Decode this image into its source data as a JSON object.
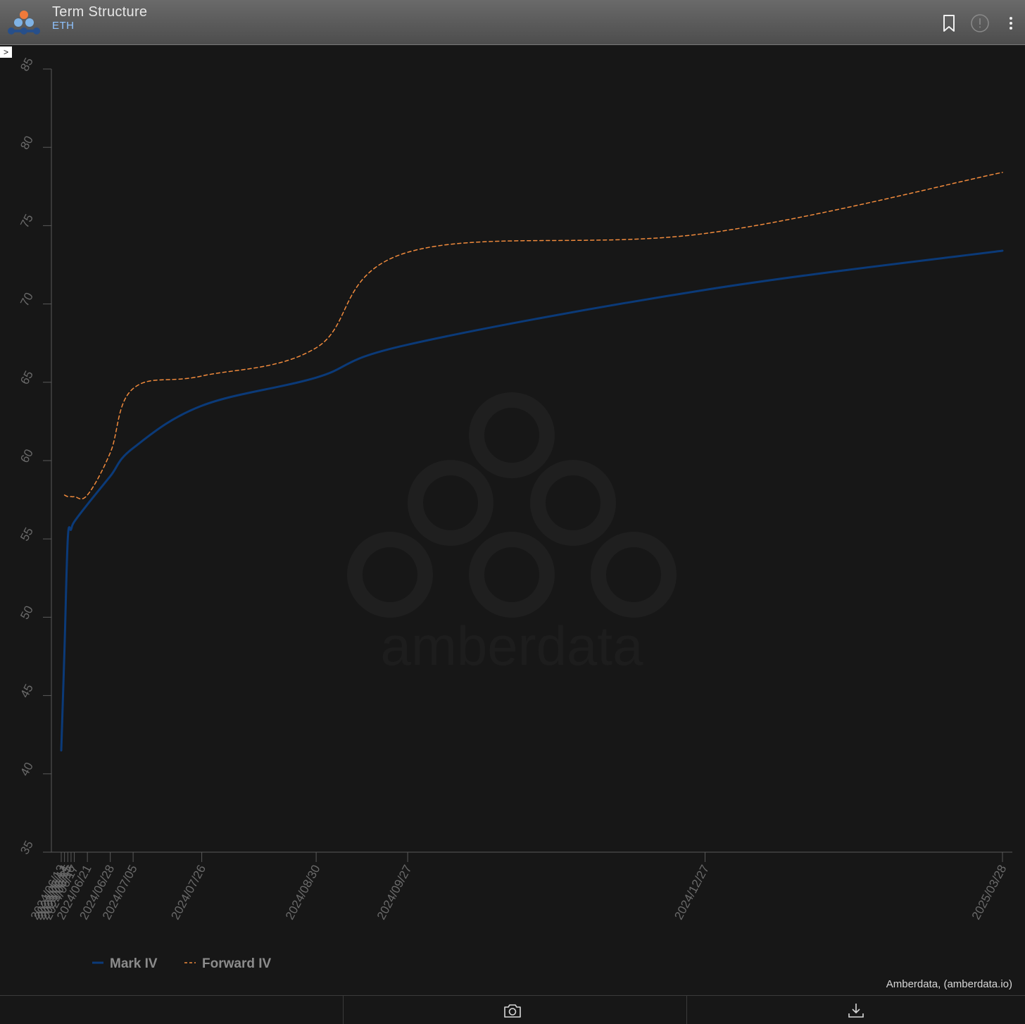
{
  "header": {
    "title": "Term Structure",
    "subtitle": "ETH"
  },
  "icons": {
    "logo": "amberdata-logo-icon",
    "bookmark": "bookmark-icon",
    "info": "alert-circle-icon",
    "menu": "vertical-dots-icon",
    "collapse": "chevron-right-icon",
    "camera": "camera-icon",
    "download": "download-icon"
  },
  "collapse_label": ">",
  "watermark": "amberdata",
  "credit": "Amberdata, (amberdata.io)",
  "colors": {
    "background": "#171717",
    "mark_iv": "#0b3a78",
    "forward_iv": "#f08a3c",
    "accent": "#8fc3ff"
  },
  "chart_data": {
    "type": "line",
    "title": "",
    "xlabel": "",
    "ylabel": "",
    "ylim": [
      35,
      85
    ],
    "y_ticks": [
      35,
      40,
      45,
      50,
      55,
      60,
      65,
      70,
      75,
      80,
      85
    ],
    "x_ticks": [
      "2024/06/13",
      "2024/06/14",
      "2024/06/15",
      "2024/06/16",
      "2024/06/17",
      "2024/06/21",
      "2024/06/28",
      "2024/07/05",
      "2024/07/26",
      "2024/08/30",
      "2024/09/27",
      "2024/12/27",
      "2025/03/28"
    ],
    "legend_position": "bottom-left",
    "grid": false,
    "series": [
      {
        "name": "Mark IV",
        "line_style": "solid",
        "x": [
          "2024/06/13",
          "2024/06/14",
          "2024/06/15",
          "2024/06/16",
          "2024/06/17",
          "2024/06/21",
          "2024/06/28",
          "2024/07/05",
          "2024/07/26",
          "2024/08/30",
          "2024/09/27",
          "2024/12/27",
          "2025/03/28"
        ],
        "values": [
          41.5,
          48.0,
          55.0,
          55.6,
          56.1,
          57.2,
          59.0,
          60.8,
          63.5,
          65.3,
          67.4,
          70.9,
          73.4
        ]
      },
      {
        "name": "Forward IV",
        "line_style": "dashed",
        "x": [
          "2024/06/14",
          "2024/06/15",
          "2024/06/16",
          "2024/06/17",
          "2024/06/21",
          "2024/06/28",
          "2024/07/05",
          "2024/07/26",
          "2024/08/30",
          "2024/09/27",
          "2024/12/27",
          "2025/03/28"
        ],
        "values": [
          57.8,
          57.7,
          57.7,
          57.7,
          57.8,
          60.5,
          64.6,
          65.4,
          67.2,
          73.3,
          74.5,
          78.4
        ]
      }
    ]
  }
}
